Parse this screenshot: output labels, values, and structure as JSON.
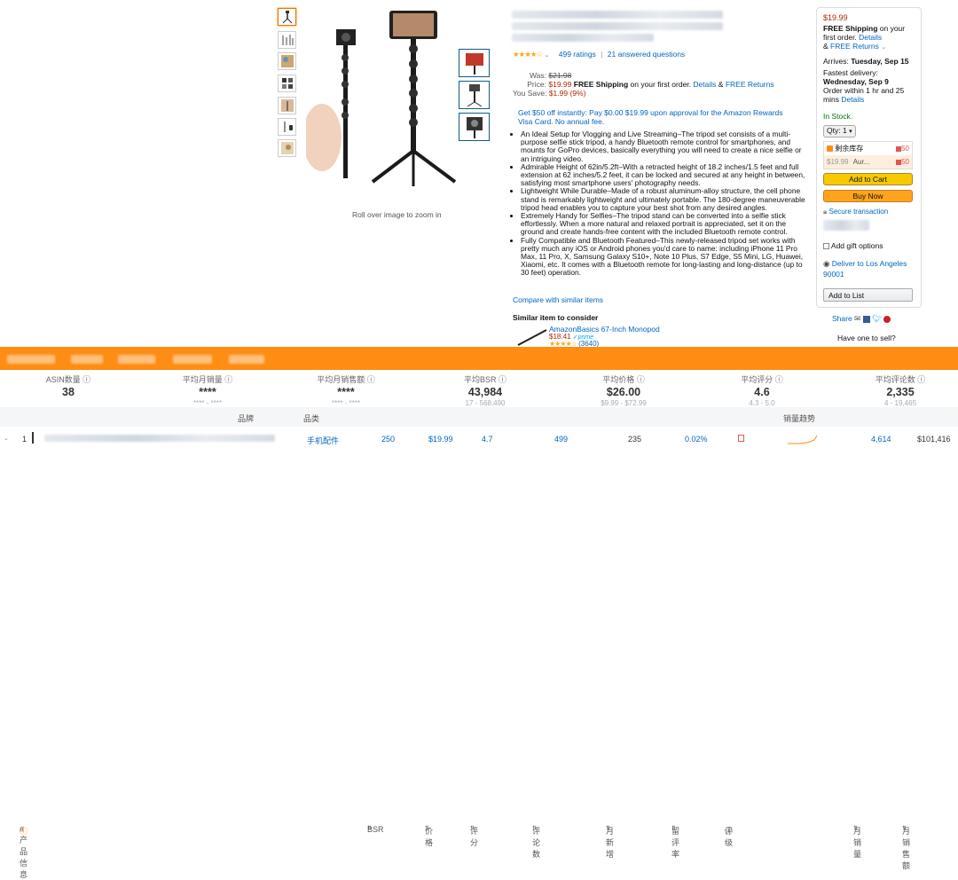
{
  "product": {
    "ratings": "499 ratings",
    "answered": "21 answered questions",
    "zoom_hint": "Roll over image to zoom in",
    "was_label": "Was:",
    "was_price": "$21.98",
    "price_label": "Price:",
    "price": "$19.99",
    "free_shipping": "FREE Shipping",
    "shipping_rest": "on your first order.",
    "details": "Details",
    "amp": "&",
    "free_returns": "FREE Returns",
    "save_label": "You Save:",
    "save_value": "$1.99 (9%)",
    "promo": "Get $50 off instantly: Pay $0.00 $19.99 upon approval for the Amazon Rewards Visa Card. No annual fee.",
    "bullets": [
      "An Ideal Setup for Vlogging and Live Streaming–The tripod set consists of a multi-purpose selfie stick tripod, a handy Bluetooth remote control for smartphones, and mounts for GoPro devices, basically everything you will need to create a nice selfie or an intriguing video.",
      "Admirable Height of 62in/5.2ft–With a retracted height of 18.2 inches/1.5 feet and full extension at 62 inches/5.2 feet, it can be locked and secured at any height in between, satisfying most smartphone users' photography needs.",
      "Lightweight While Durable–Made of a robust aluminum-alloy structure, the cell phone stand is remarkably lightweight and ultimately portable. The 180-degree maneuverable tripod head enables you to capture your best shot from any desired angles.",
      "Extremely Handy for Selfies–The tripod stand can be converted into a selfie stick effortlessly. When a more natural and relaxed portrait is appreciated, set it on the ground and create hands-free content with the included Bluetooth remote control.",
      "Fully Compatible and Bluetooth Featured–This newly-released tripod set works with pretty much any iOS or Android phones you'd care to name: including iPhone 11 Pro Max, 11 Pro, X, Samsung Galaxy S10+, Note 10 Plus, S7 Edge, S5 Mini, LG, Huawei, Xiaomi, etc. It comes with a Bluetooth remote for long-lasting and long-distance (up to 30 feet) operation."
    ],
    "compare": "Compare with similar items",
    "similar_title": "Similar item to consider",
    "similar_name": "AmazonBasics 67-Inch Monopod",
    "similar_price": "$18.41",
    "similar_prime": "prime",
    "similar_count": "(3640)"
  },
  "buybox": {
    "price": "$19.99",
    "free_shipping": "FREE Shipping",
    "ship_rest": "on your first order.",
    "details": "Details",
    "amp": "&",
    "free_returns": "FREE Returns",
    "arrives_label": "Arrives:",
    "arrives_date": "Tuesday, Sep 15",
    "fastest_label": "Fastest delivery:",
    "fastest_date": "Wednesday, Sep 9",
    "order_within": "Order within 1 hr and 25 mins",
    "order_details": "Details",
    "in_stock": "In Stock.",
    "qty": "Qty: 1",
    "stock_label": "剩余库存",
    "stock_count": "50",
    "seller_price": "$19.99",
    "seller_name": "Aur...",
    "seller_count": "50",
    "add_to_cart": "Add to Cart",
    "buy_now": "Buy Now",
    "secure": "Secure transaction",
    "gift": "Add gift options",
    "deliver": "Deliver to Los Angeles 90001",
    "add_to_list": "Add to List",
    "share": "Share",
    "sell": "Have one to sell?"
  },
  "stats": [
    {
      "label": "ASIN数量",
      "value": "38",
      "sub": ""
    },
    {
      "label": "平均月销量",
      "value": "****",
      "sub": "**** - ****"
    },
    {
      "label": "平均月销售额",
      "value": "****",
      "sub": "**** - ****"
    },
    {
      "label": "平均BSR",
      "value": "43,984",
      "sub": "17 - 568,490"
    },
    {
      "label": "平均价格",
      "value": "$26.00",
      "sub": "$9.99 - $72.99"
    },
    {
      "label": "平均评分",
      "value": "4.6",
      "sub": "4.3 - 5.0"
    },
    {
      "label": "平均评论数",
      "value": "2,335",
      "sub": "4 - 19,465"
    }
  ],
  "table": {
    "headers": [
      "# 产品信息",
      "品牌",
      "品类",
      "BSR",
      "价格",
      "评分",
      "评论数",
      "月新增",
      "留评率",
      "评级",
      "销量趋势",
      "月销量",
      "月销售额"
    ],
    "row": {
      "index": "1",
      "category": "手机配件",
      "bsr": "250",
      "price": "$19.99",
      "rating": "4.7",
      "reviews": "499",
      "monthly_new": "235",
      "review_rate": "0.02%",
      "monthly_sales": "4,614",
      "monthly_revenue": "$101,416"
    }
  },
  "colors": {
    "accent": "#ff8c13",
    "link": "#0066c0",
    "price": "#b12704",
    "cart": "#f7ca00",
    "buy": "#ffa41c",
    "stock": "#007600"
  }
}
